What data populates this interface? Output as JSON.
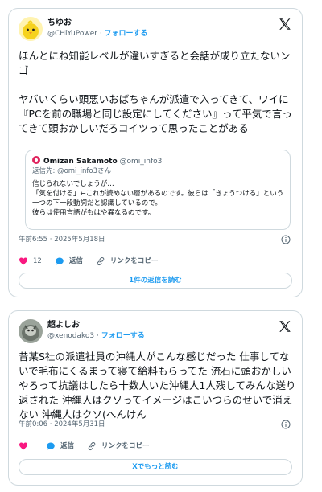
{
  "tweets": [
    {
      "author_name": "ちゆお",
      "author_handle": "@CHiYuPower",
      "follow_label": "フォローする",
      "text": "ほんとにね知能レベルが違いすぎると会話が成り立たないンゴ\n\nヤバいくらい頭悪いおばちゃんが派遣で入ってきて、ワイに『PCを前の職場と同じ設定にしてください』って平気で言ってきて頭おかしいだろコイツって思ったことがある",
      "quote": {
        "author_name": "Omizan Sakamoto",
        "author_handle": "@omi_info3",
        "reply_prefix": "返信先: ",
        "reply_handle": "@omi_info3",
        "reply_suffix": "さん",
        "text": "信じられないでしょうが…\n「気を付ける」←これが読めない層があるのです。彼らは「きょうつける」という一つの下一段動詞だと認識しているので。\n彼らは使用言語がもはや異なるのです。"
      },
      "timestamp": "午前6:55 · 2025年5月18日",
      "like_count": "12",
      "reply_label": "返信",
      "copy_link_label": "リンクをコピー",
      "cta_label": "1件の返信を読む",
      "like_color": "#f91880"
    },
    {
      "author_name": "超よしお",
      "author_handle": "@xenodako3",
      "follow_label": "フォローする",
      "text": "昔某S社の派遣社員の沖縄人がこんな感じだった 仕事してないで毛布にくるまって寝て給料もらってた 流石に頭おかしいやろって抗議はしたら十数人いた沖縄人1人残してみんな送り返された 沖縄人はクソってイメージはこいつらのせいで消えない 沖縄人はクソ(へんけん",
      "timestamp": "午前0:06 · 2024年5月31日",
      "reply_label": "返信",
      "copy_link_label": "リンクをコピー",
      "cta_label": "Xでもっと読む",
      "like_color": "#f91880"
    }
  ],
  "accent_color": "#1d9bf0",
  "icons": {
    "brand": "x-logo-icon",
    "info": "info-icon",
    "like": "heart-icon",
    "reply": "speech-bubble-icon",
    "link": "link-icon"
  }
}
